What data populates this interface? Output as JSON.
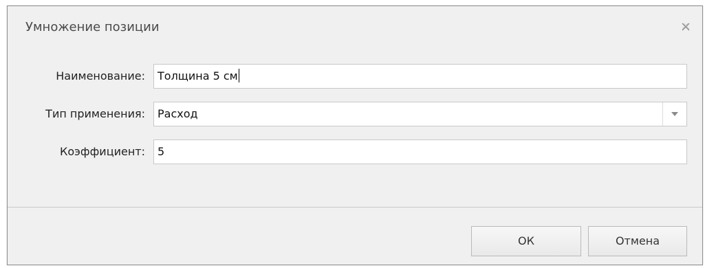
{
  "dialog": {
    "title": "Умножение позиции",
    "close_icon": "close-icon"
  },
  "form": {
    "name": {
      "label": "Наименование:",
      "value": "Толщина 5 см"
    },
    "usage_type": {
      "label": "Тип применения:",
      "value": "Расход",
      "dropdown_icon": "chevron-down-icon"
    },
    "coefficient": {
      "label": "Коэффициент:",
      "value": "5"
    }
  },
  "buttons": {
    "ok": "ОК",
    "cancel": "Отмена"
  },
  "colors": {
    "dialog_background": "#f0f0f0",
    "field_border": "#c8c8c8",
    "title_text": "#4a4a4a"
  }
}
